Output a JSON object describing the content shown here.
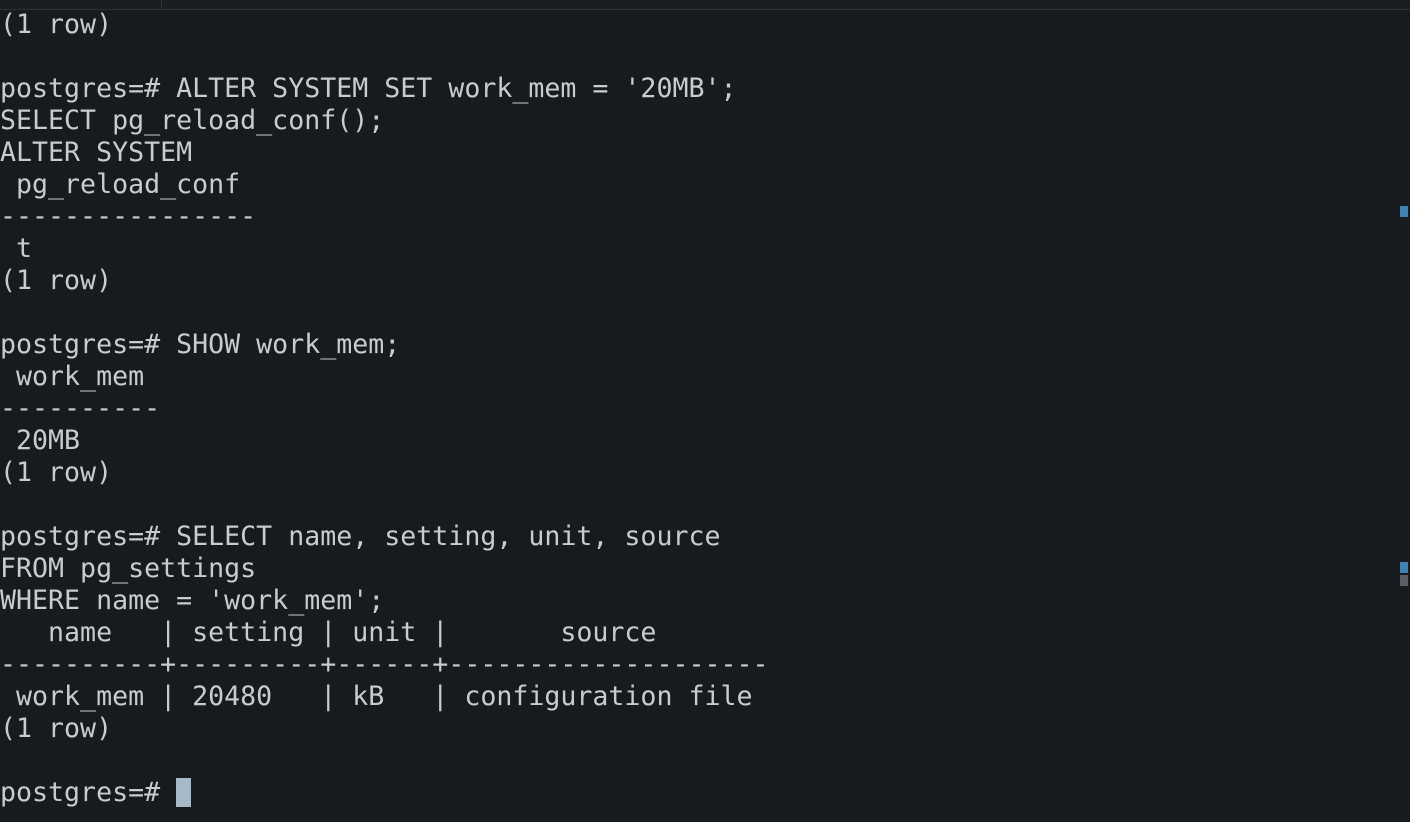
{
  "terminal": {
    "lines": [
      "(1 row)",
      "",
      "postgres=# ALTER SYSTEM SET work_mem = '20MB';",
      "SELECT pg_reload_conf();",
      "ALTER SYSTEM",
      " pg_reload_conf",
      "----------------",
      " t",
      "(1 row)",
      "",
      "postgres=# SHOW work_mem;",
      " work_mem",
      "----------",
      " 20MB",
      "(1 row)",
      "",
      "postgres=# SELECT name, setting, unit, source",
      "FROM pg_settings",
      "WHERE name = 'work_mem';",
      "   name   | setting | unit |       source",
      "----------+---------+------+--------------------",
      " work_mem | 20480   | kB   | configuration file",
      "(1 row)",
      ""
    ],
    "prompt": "postgres=# "
  },
  "colors": {
    "background": "#171b20",
    "text": "#c7ccd1",
    "cursor": "#a7b8c6",
    "scroll_marker": "#3d84b3"
  }
}
